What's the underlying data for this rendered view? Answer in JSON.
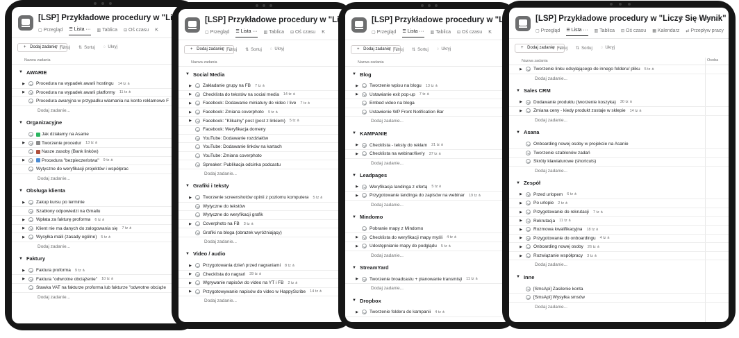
{
  "devices": [
    {
      "title": "[LSP] Przykładowe procedury w \"Liczy Się W",
      "tabs": [
        "Przegląd",
        "Lista",
        "Tablica",
        "Oś czasu",
        "K"
      ],
      "add_task": "Dodaj zadanie",
      "tools": [
        "Filtruj",
        "Sortuj",
        "Ukryj"
      ],
      "column": "Nazwa zadania",
      "sections": [
        {
          "name": "AWARIE",
          "tasks": [
            {
              "c": true,
              "t": "Procedura na wypadek awarii hostingu",
              "s": "14 tz"
            },
            {
              "c": true,
              "t": "Procedura na wypadek awarii platformy",
              "s": "11 tz"
            },
            {
              "c": false,
              "t": "Procedura awaryjna w przypadku włamania na konto reklamowe F",
              "s": ""
            }
          ],
          "add": "Dodaj zadanie..."
        },
        {
          "name": "Organizacyjne",
          "tasks": [
            {
              "c": false,
              "t": "Jak działamy na Asanie",
              "s": "",
              "e": "#2bb560"
            },
            {
              "c": true,
              "t": "Tworzenie procedur",
              "s": "13 tz",
              "e": "#8a8a8a"
            },
            {
              "c": false,
              "t": "Nasze zasoby (Bank linków)",
              "s": "",
              "e": "#b0503c"
            },
            {
              "c": true,
              "t": "Procedura \"bezpieczeństwa\"",
              "s": "9 tz",
              "e": "#4a8bd4"
            },
            {
              "c": false,
              "t": "Wytyczne do weryfikacji projektów i współprac",
              "s": ""
            }
          ],
          "add": "Dodaj zadanie..."
        },
        {
          "name": "Obsługa klienta",
          "tasks": [
            {
              "c": true,
              "t": "Zakup kursu po terminie",
              "s": ""
            },
            {
              "c": false,
              "t": "Szablony odpowiedzi na Gmailu",
              "s": ""
            },
            {
              "c": true,
              "t": "Wpłata za fakturę proforma",
              "s": "6 tz"
            },
            {
              "c": true,
              "t": "Klient nie ma danych do zalogowania się",
              "s": "7 tz"
            },
            {
              "c": true,
              "t": "Wysyłka maili (zasady ogólne)",
              "s": "5 tz"
            }
          ],
          "add": "Dodaj zadanie..."
        },
        {
          "name": "Faktury",
          "tasks": [
            {
              "c": true,
              "t": "Faktura proforma",
              "s": "9 tz"
            },
            {
              "c": true,
              "t": "Faktura \"odwrotne obciążenie\"",
              "s": "10 tz"
            },
            {
              "c": false,
              "t": "Stawka VAT na fakturze proforma lub fakturze \"odwrotne obciąże",
              "s": ""
            }
          ],
          "add": "Dodaj zadanie..."
        }
      ]
    },
    {
      "title": "[LSP] Przykładowe procedury w \"Liczy Się W",
      "tabs": [
        "Przegląd",
        "Lista",
        "Tablica",
        "Oś czasu",
        "K"
      ],
      "add_task": "Dodaj zadanie",
      "tools": [
        "Filtruj",
        "Sortuj",
        "Ukryj"
      ],
      "column": "Nazwa zadania",
      "sections": [
        {
          "name": "Social Media",
          "tasks": [
            {
              "c": true,
              "t": "Zakładanie grupy na FB",
              "s": "7 tz"
            },
            {
              "c": true,
              "t": "Checklista do tekstów na social media",
              "s": "14 tz"
            },
            {
              "c": true,
              "t": "Facebook: Dodawanie miniatury do video / live",
              "s": "7 tz"
            },
            {
              "c": true,
              "t": "Facebook: Zmiana coverphoto",
              "s": "9 tz"
            },
            {
              "c": true,
              "t": "Facebook: \"Klikalny\" post (post z linkiem)",
              "s": "5 tz"
            },
            {
              "c": false,
              "t": "Facebook: Weryfikacja domeny",
              "s": ""
            },
            {
              "c": false,
              "t": "YouTube: Dodawanie rozdziałów",
              "s": ""
            },
            {
              "c": false,
              "t": "YouTube: Dodawanie linków na kartach",
              "s": ""
            },
            {
              "c": false,
              "t": "YouTube: Zmiana coverphoto",
              "s": ""
            },
            {
              "c": false,
              "t": "Spreaker: Publikacja odcinka podcastu",
              "s": ""
            }
          ],
          "add": "Dodaj zadanie..."
        },
        {
          "name": "Grafiki i teksty",
          "tasks": [
            {
              "c": true,
              "t": "Tworzenie screenshotów opinii z poziomu komputera",
              "s": "5 tz"
            },
            {
              "c": false,
              "t": "Wytyczne do tekstów",
              "s": ""
            },
            {
              "c": false,
              "t": "Wytyczne do weryfikacji grafik",
              "s": ""
            },
            {
              "c": true,
              "t": "Coverphoto na FB",
              "s": "3 tz"
            },
            {
              "c": false,
              "t": "Grafiki na bloga (obrazek wyróżniający)",
              "s": ""
            }
          ],
          "add": "Dodaj zadanie..."
        },
        {
          "name": "Video / audio",
          "tasks": [
            {
              "c": true,
              "t": "Przygotowania dzień przed nagraniami",
              "s": "8 tz"
            },
            {
              "c": true,
              "t": "Checklista do nagrań",
              "s": "39 tz"
            },
            {
              "c": true,
              "t": "Wgrywanie napisów do video na YT i FB",
              "s": "2 tz"
            },
            {
              "c": true,
              "t": "Przygotowywanie napisów do video w HappyScribe",
              "s": "14 tz"
            }
          ],
          "add": "Dodaj zadanie..."
        }
      ]
    },
    {
      "title": "[LSP] Przykładowe procedury w \"Liczy Się W",
      "tabs": [
        "Przegląd",
        "Lista",
        "Tablica",
        "Oś czasu",
        "K"
      ],
      "add_task": "Dodaj zadanie",
      "tools": [
        "Filtruj",
        "Sortuj",
        "Ukryj"
      ],
      "column": "Nazwa zadania",
      "sections": [
        {
          "name": "Blog",
          "tasks": [
            {
              "c": true,
              "t": "Tworzenie wpisu na blogu",
              "s": "13 tz"
            },
            {
              "c": true,
              "t": "Ustawianie exit pop-up",
              "s": "7 tz"
            },
            {
              "c": false,
              "t": "Embed video na bloga",
              "s": ""
            },
            {
              "c": false,
              "t": "Ustawienie WP Front Notification Bar",
              "s": ""
            }
          ],
          "add": "Dodaj zadanie..."
        },
        {
          "name": "KAMPANIE",
          "tasks": [
            {
              "c": true,
              "t": "Checklista - teksty do reklam",
              "s": "21 tz"
            },
            {
              "c": true,
              "t": "Checklista na webinar/live'y",
              "s": "37 tz"
            }
          ],
          "add": "Dodaj zadanie..."
        },
        {
          "name": "Leadpages",
          "tasks": [
            {
              "c": true,
              "t": "Weryfikacja landinga z ofertą",
              "s": "5 tz"
            },
            {
              "c": true,
              "t": "Przygotowanie landinga do zapisów na webinar",
              "s": "19 tz"
            }
          ],
          "add": "Dodaj zadanie..."
        },
        {
          "name": "Mindomo",
          "tasks": [
            {
              "c": false,
              "t": "Pobranie mapy z Mindomo",
              "s": ""
            },
            {
              "c": true,
              "t": "Checklista do weryfikacji mapy myśli",
              "s": "4 tz"
            },
            {
              "c": true,
              "t": "Udostępnianie mapy do podglądu",
              "s": "5 tz"
            }
          ],
          "add": "Dodaj zadanie..."
        },
        {
          "name": "StreamYard",
          "tasks": [
            {
              "c": true,
              "t": "Tworzenie broadcastu + planowanie transmisji",
              "s": "11 tz"
            }
          ],
          "add": "Dodaj zadanie..."
        },
        {
          "name": "Dropbox",
          "tasks": [
            {
              "c": true,
              "t": "Tworzenie folderu do kampanii",
              "s": "4 tz"
            }
          ],
          "add": ""
        }
      ]
    },
    {
      "title": "[LSP] Przykładowe procedury w \"Liczy Się Wynik\"",
      "tabs": [
        "Przegląd",
        "Lista",
        "Tablica",
        "Oś czasu",
        "Kalendarz",
        "Przepływ pracy"
      ],
      "status": "Ustaw s",
      "add_task": "Dodaj zadanie",
      "tools": [
        "Filtruj",
        "Sortuj",
        "Ukryj"
      ],
      "column": "Nazwa zadania",
      "column2": "Osoba",
      "sections": [
        {
          "name": "",
          "tasks": [
            {
              "c": true,
              "t": "Tworzenie linku odsyłającego do innego folderu/ pliku",
              "s": "5 tz"
            }
          ],
          "add": "Dodaj zadanie..."
        },
        {
          "name": "Sales CRM",
          "tasks": [
            {
              "c": true,
              "t": "Dodawanie produktu (tworzenie koszyka)",
              "s": "30 tz"
            },
            {
              "c": true,
              "t": "Zmiana ceny - kiedy produkt zostaje w sklepie",
              "s": "14 tz"
            }
          ],
          "add": "Dodaj zadanie..."
        },
        {
          "name": "Asana",
          "tasks": [
            {
              "c": false,
              "t": "Onboarding nowej osoby w projekcie na Asanie",
              "s": ""
            },
            {
              "c": false,
              "t": "Tworzenie szablonów zadań",
              "s": ""
            },
            {
              "c": false,
              "t": "Skróty klawiaturowe (shortcuts)",
              "s": ""
            }
          ],
          "add": "Dodaj zadanie..."
        },
        {
          "name": "Zespół",
          "tasks": [
            {
              "c": true,
              "t": "Przed urlopem",
              "s": "6 tz"
            },
            {
              "c": true,
              "t": "Po urlopie",
              "s": "2 tz"
            },
            {
              "c": true,
              "t": "Przygotowanie do rekrutacji",
              "s": "7 tz"
            },
            {
              "c": true,
              "t": "Rekrutacja",
              "s": "11 tz"
            },
            {
              "c": true,
              "t": "Rozmowa kwalifikacyjna",
              "s": "18 tz"
            },
            {
              "c": true,
              "t": "Przygotowanie do onboardingu",
              "s": "4 tz"
            },
            {
              "c": true,
              "t": "Onboarding nowej osoby",
              "s": "26 tz"
            },
            {
              "c": true,
              "t": "Rozwiązanie współpracy",
              "s": "3 tz"
            }
          ],
          "add": "Dodaj zadanie..."
        },
        {
          "name": "Inne",
          "tasks": [
            {
              "c": false,
              "t": "[SmsApi] Zasilenie konta",
              "s": ""
            },
            {
              "c": false,
              "t": "[SmsApi] Wysyłka smsów",
              "s": ""
            }
          ],
          "add": "Dodaj zadanie..."
        }
      ]
    }
  ]
}
